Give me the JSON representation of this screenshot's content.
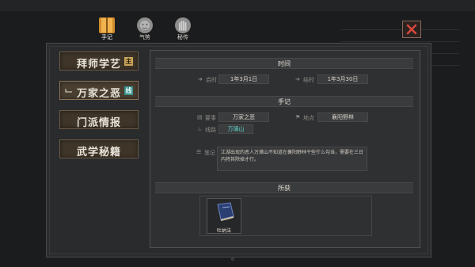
{
  "top_tabs": [
    {
      "label": "手记",
      "icon": "journal-book-icon",
      "active": true
    },
    {
      "label": "气势",
      "icon": "lion-head-icon",
      "active": false
    },
    {
      "label": "秘传",
      "icon": "hand-scroll-icon",
      "active": false
    }
  ],
  "sidebar": {
    "items": [
      {
        "label": "拜师学艺",
        "badge": "主",
        "badge_kind": "main",
        "selected": false
      },
      {
        "label": "万家之恶",
        "badge": "线",
        "badge_kind": "side",
        "selected": true
      },
      {
        "label": "门派情报",
        "badge": "",
        "selected": false
      },
      {
        "label": "武学秘籍",
        "badge": "",
        "selected": false
      }
    ]
  },
  "sections": {
    "time": {
      "title": "时间",
      "start_label": "启时",
      "start_value": "1年3月1日",
      "end_label": "结时",
      "end_value": "1年3月30日"
    },
    "notes": {
      "title": "手记",
      "event_label": "要事",
      "event_value": "万家之恶",
      "location_label": "地点",
      "location_value": "襄阳野林",
      "clue_label": "线路",
      "clue_value": "万璜山",
      "memo_label": "笔记",
      "memo_text": "江湖出现的恶人万璜山不知道在襄阳野林干些什么勾当，需要在三日内将其除掉才行。"
    },
    "rewards": {
      "title": "所获",
      "items": [
        {
          "name": "吐纳法",
          "icon": "book-icon"
        }
      ]
    }
  },
  "colors": {
    "badge_main": "#c9a45a",
    "badge_side": "#3a8f89",
    "accent_cyan": "#5fd6cf"
  }
}
